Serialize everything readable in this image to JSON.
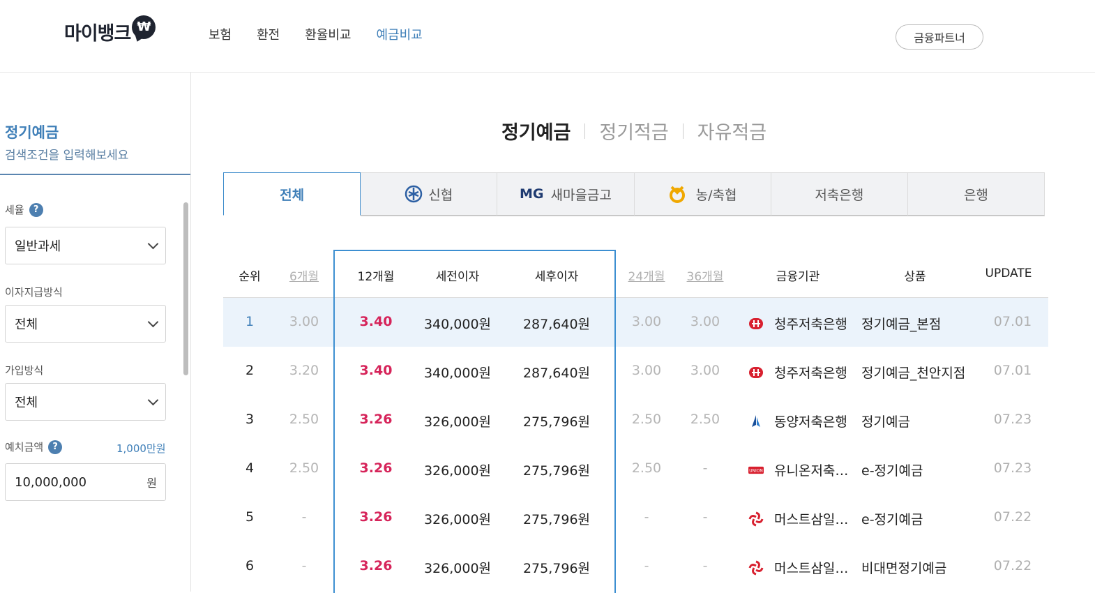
{
  "header": {
    "logo_text": "마이뱅크",
    "logo_badge": "₩",
    "nav": [
      "보험",
      "환전",
      "환율비교",
      "예금비교"
    ],
    "active_nav": "예금비교",
    "partner_button": "금융파트너"
  },
  "sidebar": {
    "title": "정기예금",
    "subtitle": "검색조건을 입력해보세요",
    "tax_label": "세율",
    "tax_value": "일반과세",
    "interest_label": "이자지급방식",
    "interest_value": "전체",
    "join_label": "가입방식",
    "join_value": "전체",
    "amount_label": "예치금액",
    "amount_hint": "1,000만원",
    "amount_value": "10,000,000",
    "amount_unit": "원",
    "help": "?"
  },
  "type_tabs": [
    "정기예금",
    "정기적금",
    "자유적금"
  ],
  "category_tabs": [
    "전체",
    "신협",
    "새마을금고",
    "농/축협",
    "저축은행",
    "은행"
  ],
  "mg_label": "MG",
  "table": {
    "headers": {
      "rank": "순위",
      "m6": "6개월",
      "m12": "12개월",
      "pre": "세전이자",
      "post": "세후이자",
      "m24": "24개월",
      "m36": "36개월",
      "bank": "금융기관",
      "product": "상품",
      "update": "UPDATE"
    },
    "rows": [
      {
        "rank": "1",
        "m6": "3.00",
        "m12": "3.40",
        "pre": "340,000원",
        "post": "287,640원",
        "m24": "3.00",
        "m36": "3.00",
        "bank": "청주저축은행",
        "product": "정기예금_본점",
        "update": "07.01",
        "icon": "cheongju"
      },
      {
        "rank": "2",
        "m6": "3.20",
        "m12": "3.40",
        "pre": "340,000원",
        "post": "287,640원",
        "m24": "3.00",
        "m36": "3.00",
        "bank": "청주저축은행",
        "product": "정기예금_천안지점",
        "update": "07.01",
        "icon": "cheongju"
      },
      {
        "rank": "3",
        "m6": "2.50",
        "m12": "3.26",
        "pre": "326,000원",
        "post": "275,796원",
        "m24": "2.50",
        "m36": "2.50",
        "bank": "동양저축은행",
        "product": "정기예금",
        "update": "07.23",
        "icon": "dongyang"
      },
      {
        "rank": "4",
        "m6": "2.50",
        "m12": "3.26",
        "pre": "326,000원",
        "post": "275,796원",
        "m24": "2.50",
        "m36": "-",
        "bank": "유니온저축…",
        "product": "e-정기예금",
        "update": "07.23",
        "icon": "union"
      },
      {
        "rank": "5",
        "m6": "-",
        "m12": "3.26",
        "pre": "326,000원",
        "post": "275,796원",
        "m24": "-",
        "m36": "-",
        "bank": "머스트삼일…",
        "product": "e-정기예금",
        "update": "07.22",
        "icon": "must"
      },
      {
        "rank": "6",
        "m6": "-",
        "m12": "3.26",
        "pre": "326,000원",
        "post": "275,796원",
        "m24": "-",
        "m36": "-",
        "bank": "머스트삼일…",
        "product": "비대면정기예금",
        "update": "07.22",
        "icon": "must"
      }
    ]
  },
  "colors": {
    "accent": "#3f7fb8",
    "rate": "#d6245a",
    "highlight_row": "#ebf3fb",
    "highlight_border": "#3d8fd1"
  }
}
